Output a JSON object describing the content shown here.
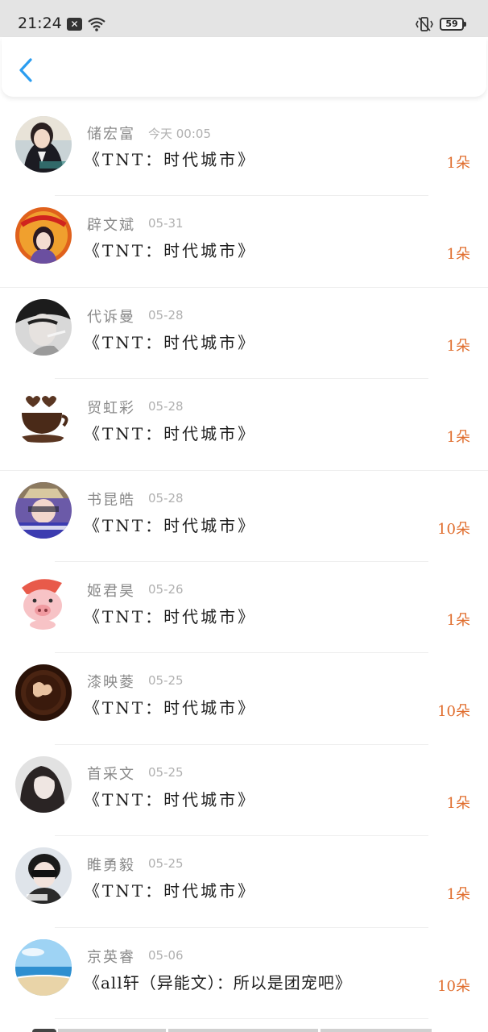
{
  "status_bar": {
    "time": "21:24",
    "notification_icon": "close-box-icon",
    "battery": "59"
  },
  "header": {
    "back_icon": "chevron-left-icon",
    "accent": "#2b9df0"
  },
  "items": [
    {
      "name": "储宏富",
      "date": "今天 00:05",
      "title": "《TNT：时代城市》",
      "amount": "1朵"
    },
    {
      "name": "辟文斌",
      "date": "05-31",
      "title": "《TNT：时代城市》",
      "amount": "1朵"
    },
    {
      "name": "代诉曼",
      "date": "05-28",
      "title": "《TNT：时代城市》",
      "amount": "1朵"
    },
    {
      "name": "贸虹彩",
      "date": "05-28",
      "title": "《TNT：时代城市》",
      "amount": "1朵"
    },
    {
      "name": "书昆皓",
      "date": "05-28",
      "title": "《TNT：时代城市》",
      "amount": "10朵"
    },
    {
      "name": "姬君昊",
      "date": "05-26",
      "title": "《TNT：时代城市》",
      "amount": "1朵"
    },
    {
      "name": "漆映菱",
      "date": "05-25",
      "title": "《TNT：时代城市》",
      "amount": "10朵"
    },
    {
      "name": "首采文",
      "date": "05-25",
      "title": "《TNT：时代城市》",
      "amount": "1朵"
    },
    {
      "name": "睢勇毅",
      "date": "05-25",
      "title": "《TNT：时代城市》",
      "amount": "1朵"
    },
    {
      "name": "京英睿",
      "date": "05-06",
      "title": "《all轩（异能文）：所以是团宠吧》",
      "amount": "10朵"
    }
  ],
  "colors": {
    "name": "#8a8a8a",
    "date": "#b0b0b0",
    "title": "#1f1f1f",
    "amount": "#e06d2d"
  }
}
